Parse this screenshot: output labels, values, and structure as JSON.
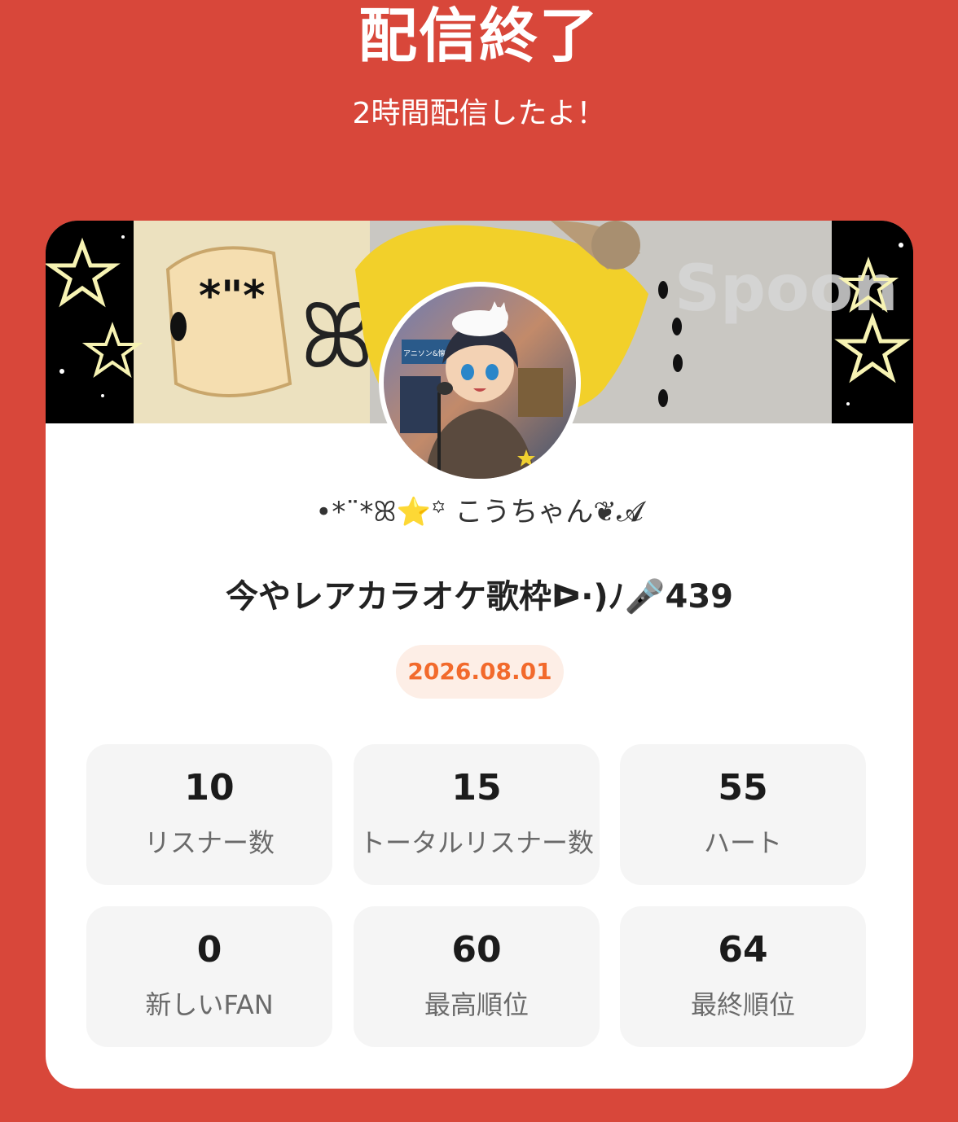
{
  "header": {
    "title": "配信終了",
    "subtitle": "2時間配信したよ！"
  },
  "profile": {
    "username": "•*¨*ꕤ⭐️꙳ こうちゃん❦𝓐",
    "stream_title": "今やレアカラオケ歌枠ᐅ·)ﾉ🎤439",
    "date": "2026.08.01",
    "avatar_sign_text": "アニソン&懐メロ 好きな人集まれ！",
    "banner_watermark": "Spoon"
  },
  "stats": [
    {
      "value": "10",
      "label": "リスナー数"
    },
    {
      "value": "15",
      "label": "トータルリスナー数"
    },
    {
      "value": "55",
      "label": "ハート"
    },
    {
      "value": "0",
      "label": "新しいFAN"
    },
    {
      "value": "60",
      "label": "最高順位"
    },
    {
      "value": "64",
      "label": "最終順位"
    }
  ],
  "colors": {
    "background": "#d8473a",
    "card": "#ffffff",
    "date_text": "#f26a2c",
    "date_bg": "#fdeee6",
    "stat_bg": "#f5f5f5"
  }
}
